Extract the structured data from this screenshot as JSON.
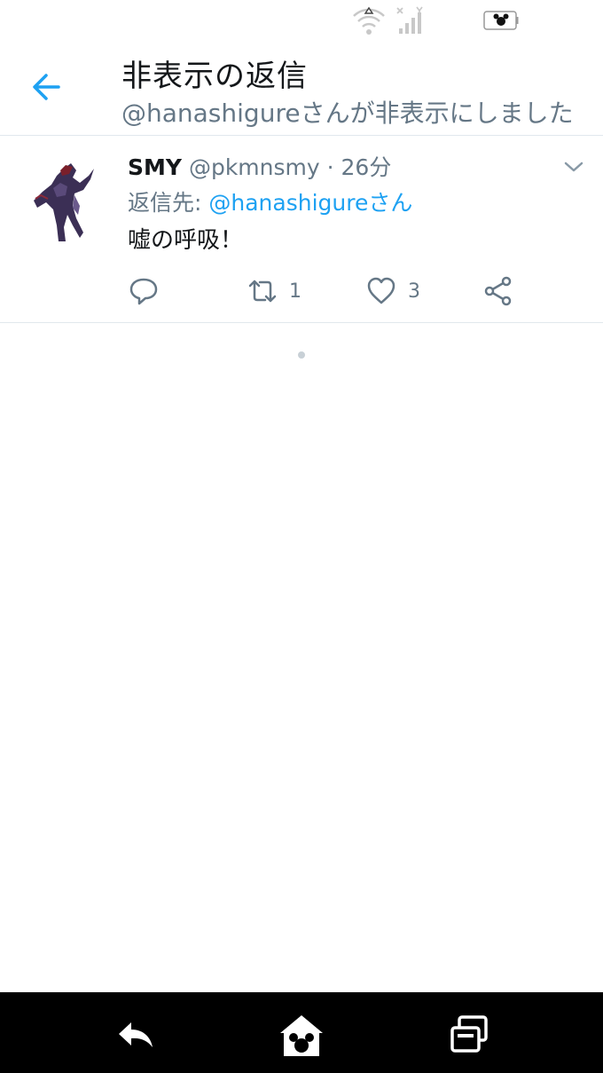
{
  "status_bar": {
    "icons": [
      "wifi-icon",
      "signal-icon",
      "battery-icon"
    ]
  },
  "header": {
    "title": "非表示の返信",
    "subtitle": "@hanashigureさんが非表示にしました",
    "back_icon": "arrow-left-icon"
  },
  "tweet": {
    "name": "SMY",
    "handle": "@pkmnsmy",
    "separator": "·",
    "time": "26分",
    "reply_prefix": "返信先: ",
    "reply_mention": "@hanashigureさん",
    "text": "嘘の呼吸！",
    "counts": {
      "retweets": "1",
      "likes": "3"
    }
  },
  "nav_bar": {
    "icons": [
      "back-icon",
      "home-icon",
      "recents-icon"
    ]
  },
  "colors": {
    "accent": "#1da1f2",
    "secondary_text": "#657786",
    "primary_text": "#14171a",
    "divider": "#e1e8ed",
    "nav_bar": "#000000"
  }
}
